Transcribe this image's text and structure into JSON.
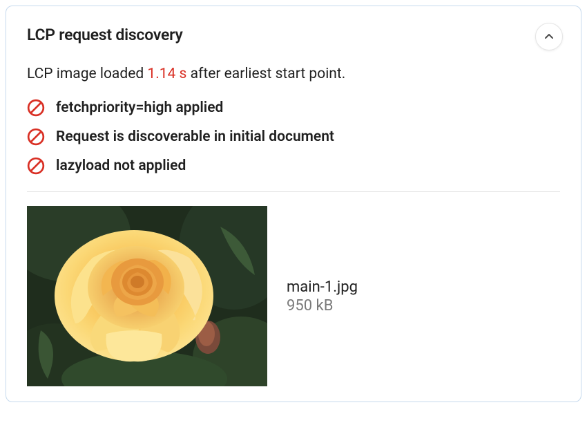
{
  "card": {
    "title": "LCP request discovery",
    "summary_prefix": "LCP image loaded ",
    "summary_value": "1.14 s",
    "summary_suffix": " after earliest start point.",
    "checks": [
      {
        "label": "fetchpriority=high applied"
      },
      {
        "label": "Request is discoverable in initial document"
      },
      {
        "label": "lazyload not applied"
      }
    ],
    "file": {
      "name": "main-1.jpg",
      "size": "950 kB"
    }
  }
}
